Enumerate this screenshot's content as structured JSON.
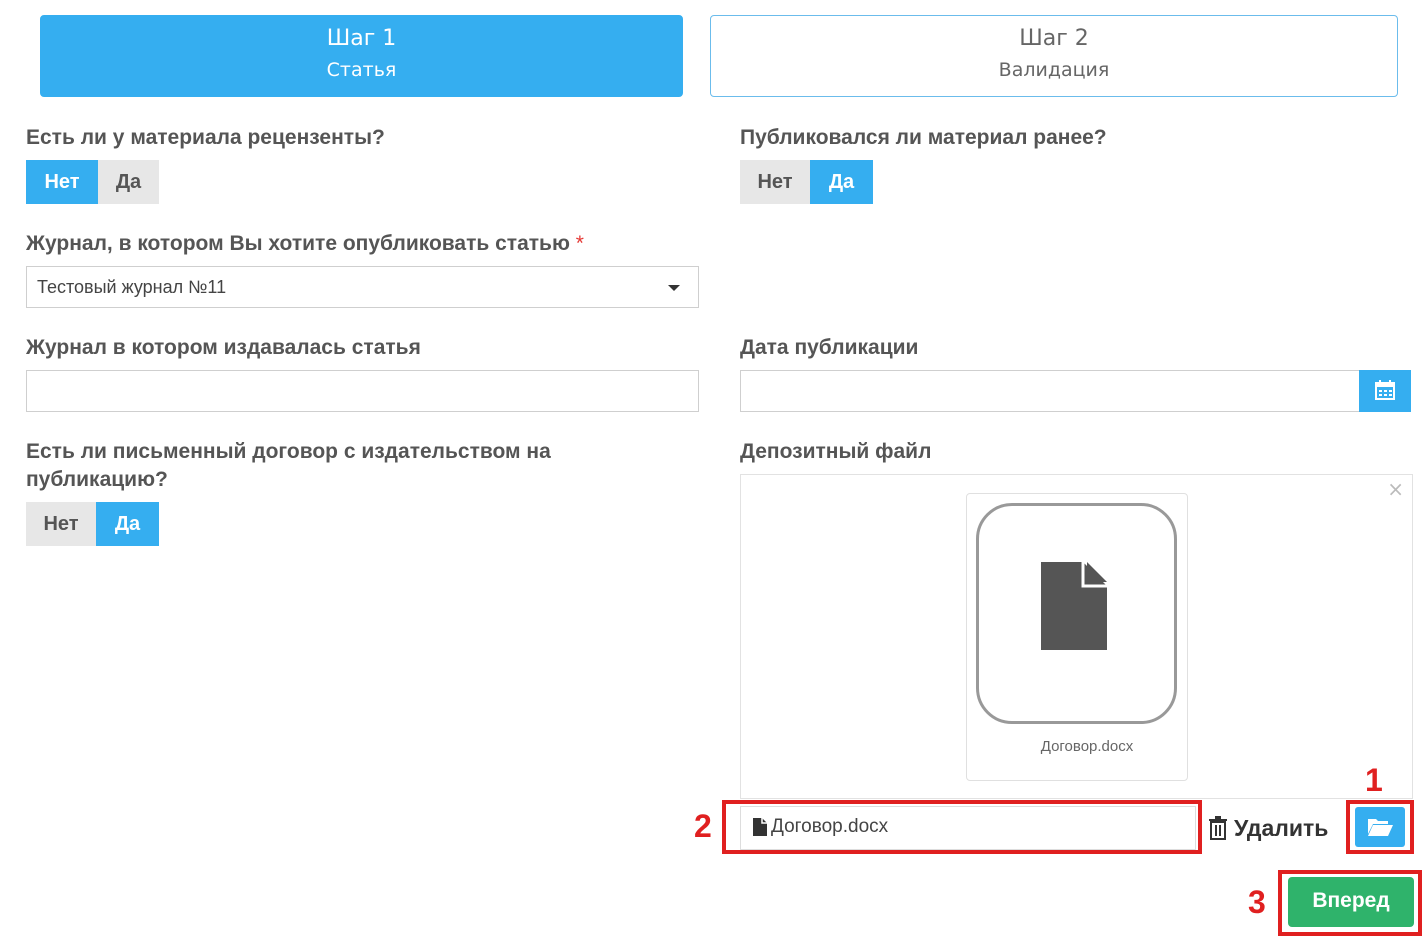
{
  "steps": [
    {
      "number": "Шаг 1",
      "name": "Статья",
      "active": true
    },
    {
      "number": "Шаг 2",
      "name": "Валидация",
      "active": false
    }
  ],
  "reviewers": {
    "question": "Есть ли у материала рецензенты?",
    "no": "Нет",
    "yes": "Да",
    "selected": "Нет"
  },
  "published_before": {
    "question": "Публиковался ли материал ранее?",
    "no": "Нет",
    "yes": "Да",
    "selected": "Да"
  },
  "journal": {
    "label": "Журнал, в котором Вы хотите опубликовать статью",
    "required_mark": "*",
    "value": "Тестовый журнал №11"
  },
  "prev_journal": {
    "label": "Журнал в котором издавалась статья",
    "value": ""
  },
  "pub_date": {
    "label": "Дата публикации",
    "value": "",
    "icon": "calendar-icon"
  },
  "contract": {
    "question": "Есть ли письменный договор с издательством на публикацию?",
    "no": "Нет",
    "yes": "Да",
    "selected": "Да"
  },
  "deposit": {
    "label": "Депозитный файл",
    "preview_filename": "Договор.docx",
    "caption_filename": "Договор.docx",
    "delete_label": "Удалить",
    "close_glyph": "×"
  },
  "next_label": "Вперед",
  "annotations": [
    "1",
    "2",
    "3"
  ],
  "colors": {
    "accent": "#35aef0",
    "success": "#2fb36b",
    "annotation": "#e02020"
  }
}
